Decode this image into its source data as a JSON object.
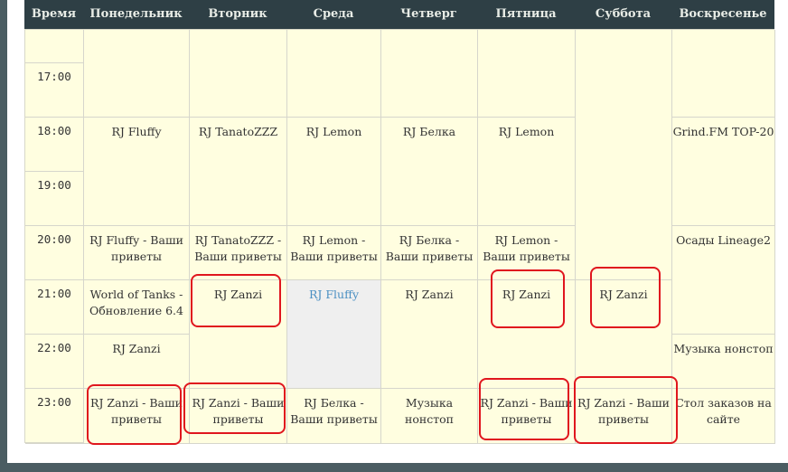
{
  "headers": [
    "Время",
    "Понедельник",
    "Вторник",
    "Среда",
    "Четверг",
    "Пятница",
    "Суббота",
    "Воскресенье"
  ],
  "times": [
    "17:00",
    "18:00",
    "19:00",
    "20:00",
    "21:00",
    "22:00",
    "23:00"
  ],
  "mon": [
    "RJ Fluffy",
    "RJ Fluffy - Ваши приветы",
    "World of Tanks - Обновление 6.4",
    "RJ Zanzi",
    "RJ Zanzi - Ваши приветы"
  ],
  "tue": [
    "RJ TanatoZZZ",
    "RJ TanatoZZZ - Ваши приветы",
    "RJ Zanzi",
    "RJ Zanzi - Ваши приветы"
  ],
  "wed": [
    "RJ Lemon",
    "RJ Lemon - Ваши приветы",
    "RJ Fluffy",
    "RJ Белка - Ваши приветы"
  ],
  "thu": [
    "RJ Белка",
    "RJ Белка - Ваши приветы",
    "RJ Zanzi",
    "Музыка нонстоп"
  ],
  "fri": [
    "RJ Lemon",
    "RJ Lemon - Ваши приветы",
    "RJ Zanzi",
    "RJ Zanzi - Ваши приветы"
  ],
  "sat": [
    "RJ Zanzi",
    "RJ Zanzi - Ваши приветы"
  ],
  "sun": [
    "Grind.FM TOP-20",
    "Осады Lineage2",
    "Музыка нонстоп",
    "Стол заказов на сайте"
  ],
  "colors": {
    "header_bg": "#2e3f45",
    "cell_bg": "#fffee0",
    "highlight": "#e0161e",
    "link": "#4a8fc2"
  }
}
